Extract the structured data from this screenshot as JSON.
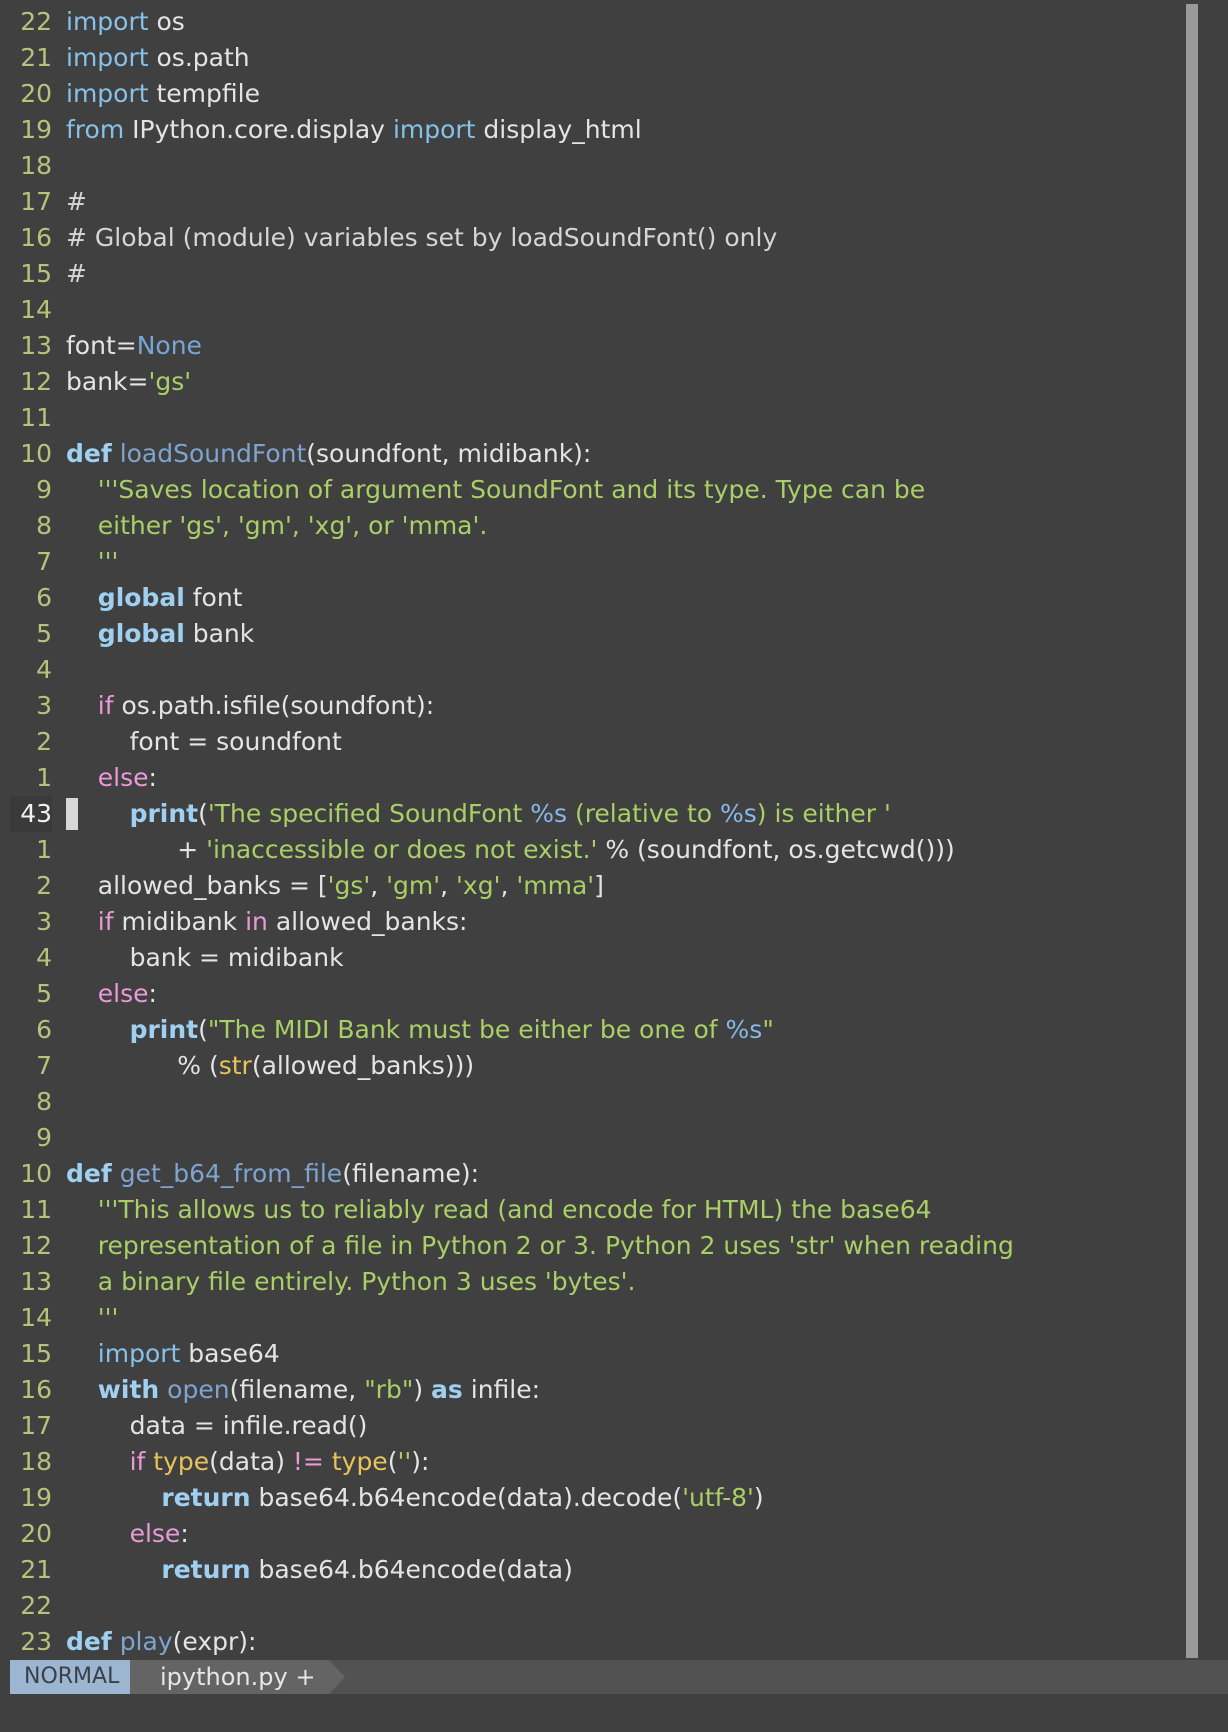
{
  "editor": {
    "lines": [
      {
        "num": "22",
        "segs": [
          [
            "kw",
            "import"
          ],
          [
            "",
            " os"
          ]
        ]
      },
      {
        "num": "21",
        "segs": [
          [
            "kw",
            "import"
          ],
          [
            "",
            " os.path"
          ]
        ]
      },
      {
        "num": "20",
        "segs": [
          [
            "kw",
            "import"
          ],
          [
            "",
            " tempfile"
          ]
        ]
      },
      {
        "num": "19",
        "segs": [
          [
            "kw",
            "from"
          ],
          [
            "",
            " IPython.core.display "
          ],
          [
            "kw",
            "import"
          ],
          [
            "",
            " display_html"
          ]
        ]
      },
      {
        "num": "18",
        "segs": []
      },
      {
        "num": "17",
        "segs": [
          [
            "cmt",
            "#"
          ]
        ]
      },
      {
        "num": "16",
        "segs": [
          [
            "cmt",
            "# Global (module) variables set by loadSoundFont() only"
          ]
        ]
      },
      {
        "num": "15",
        "segs": [
          [
            "cmt",
            "#"
          ]
        ]
      },
      {
        "num": "14",
        "segs": []
      },
      {
        "num": "13",
        "segs": [
          [
            "",
            "font="
          ],
          [
            "none",
            "None"
          ]
        ]
      },
      {
        "num": "12",
        "segs": [
          [
            "",
            "bank="
          ],
          [
            "str",
            "'gs'"
          ]
        ]
      },
      {
        "num": "11",
        "segs": []
      },
      {
        "num": "10",
        "segs": [
          [
            "kwb",
            "def"
          ],
          [
            "",
            " "
          ],
          [
            "fn",
            "loadSoundFont"
          ],
          [
            "",
            "(soundfont, midibank):"
          ]
        ]
      },
      {
        "num": "9",
        "segs": [
          [
            "",
            "    "
          ],
          [
            "str",
            "'''Saves location of argument SoundFont and its type. Type can be"
          ]
        ]
      },
      {
        "num": "8",
        "segs": [
          [
            "",
            "    "
          ],
          [
            "str",
            "either 'gs', 'gm', 'xg', or 'mma'."
          ]
        ]
      },
      {
        "num": "7",
        "segs": [
          [
            "",
            "    "
          ],
          [
            "str",
            "'''"
          ]
        ]
      },
      {
        "num": "6",
        "segs": [
          [
            "",
            "    "
          ],
          [
            "kwb",
            "global"
          ],
          [
            "",
            " font"
          ]
        ]
      },
      {
        "num": "5",
        "segs": [
          [
            "",
            "    "
          ],
          [
            "kwb",
            "global"
          ],
          [
            "",
            " bank"
          ]
        ]
      },
      {
        "num": "4",
        "segs": []
      },
      {
        "num": "3",
        "segs": [
          [
            "",
            "    "
          ],
          [
            "ctl",
            "if"
          ],
          [
            "",
            " os.path.isfile(soundfont):"
          ]
        ]
      },
      {
        "num": "2",
        "segs": [
          [
            "",
            "        font = soundfont"
          ]
        ]
      },
      {
        "num": "1",
        "segs": [
          [
            "",
            "    "
          ],
          [
            "ctl",
            "else"
          ],
          [
            "",
            ":"
          ]
        ]
      },
      {
        "num": "43",
        "current": true,
        "segs": [
          [
            "",
            "        "
          ],
          [
            "kwb",
            "print"
          ],
          [
            "",
            "("
          ],
          [
            "str",
            "'The specified SoundFont "
          ],
          [
            "fmt",
            "%s"
          ],
          [
            "str",
            " (relative to "
          ],
          [
            "fmt",
            "%s"
          ],
          [
            "str",
            ") is either '"
          ]
        ]
      },
      {
        "num": "1",
        "segs": [
          [
            "",
            "              + "
          ],
          [
            "str",
            "'inaccessible or does not exist.'"
          ],
          [
            "",
            " % (soundfont, os.getcwd()))"
          ]
        ]
      },
      {
        "num": "2",
        "segs": [
          [
            "",
            "    allowed_banks = ["
          ],
          [
            "str",
            "'gs'"
          ],
          [
            "",
            ", "
          ],
          [
            "str",
            "'gm'"
          ],
          [
            "",
            ", "
          ],
          [
            "str",
            "'xg'"
          ],
          [
            "",
            ", "
          ],
          [
            "str",
            "'mma'"
          ],
          [
            "",
            "]"
          ]
        ]
      },
      {
        "num": "3",
        "segs": [
          [
            "",
            "    "
          ],
          [
            "ctl",
            "if"
          ],
          [
            "",
            " midibank "
          ],
          [
            "ctl",
            "in"
          ],
          [
            "",
            " allowed_banks:"
          ]
        ]
      },
      {
        "num": "4",
        "segs": [
          [
            "",
            "        bank = midibank"
          ]
        ]
      },
      {
        "num": "5",
        "segs": [
          [
            "",
            "    "
          ],
          [
            "ctl",
            "else"
          ],
          [
            "",
            ":"
          ]
        ]
      },
      {
        "num": "6",
        "segs": [
          [
            "",
            "        "
          ],
          [
            "kwb",
            "print"
          ],
          [
            "",
            "("
          ],
          [
            "str",
            "\"The MIDI Bank must be either be one of "
          ],
          [
            "fmt",
            "%s"
          ],
          [
            "str",
            "\""
          ]
        ]
      },
      {
        "num": "7",
        "segs": [
          [
            "",
            "              % ("
          ],
          [
            "bi",
            "str"
          ],
          [
            "",
            "(allowed_banks)))"
          ]
        ]
      },
      {
        "num": "8",
        "segs": []
      },
      {
        "num": "9",
        "segs": []
      },
      {
        "num": "10",
        "segs": [
          [
            "kwb",
            "def"
          ],
          [
            "",
            " "
          ],
          [
            "fn",
            "get_b64_from_file"
          ],
          [
            "",
            "(filename):"
          ]
        ]
      },
      {
        "num": "11",
        "segs": [
          [
            "",
            "    "
          ],
          [
            "str",
            "'''This allows us to reliably read (and encode for HTML) the base64"
          ]
        ]
      },
      {
        "num": "12",
        "segs": [
          [
            "",
            "    "
          ],
          [
            "str",
            "representation of a file in Python 2 or 3. Python 2 uses 'str' when reading"
          ]
        ]
      },
      {
        "num": "13",
        "segs": [
          [
            "",
            "    "
          ],
          [
            "str",
            "a binary file entirely. Python 3 uses 'bytes'."
          ]
        ]
      },
      {
        "num": "14",
        "segs": [
          [
            "",
            "    "
          ],
          [
            "str",
            "'''"
          ]
        ]
      },
      {
        "num": "15",
        "segs": [
          [
            "",
            "    "
          ],
          [
            "kw",
            "import"
          ],
          [
            "",
            " base64"
          ]
        ]
      },
      {
        "num": "16",
        "segs": [
          [
            "",
            "    "
          ],
          [
            "kwb",
            "with"
          ],
          [
            "",
            " "
          ],
          [
            "fn",
            "open"
          ],
          [
            "",
            "(filename, "
          ],
          [
            "str",
            "\"rb\""
          ],
          [
            "",
            ") "
          ],
          [
            "kwb",
            "as"
          ],
          [
            "",
            " infile:"
          ]
        ]
      },
      {
        "num": "17",
        "segs": [
          [
            "",
            "        data = infile.read()"
          ]
        ]
      },
      {
        "num": "18",
        "segs": [
          [
            "",
            "        "
          ],
          [
            "ctl",
            "if"
          ],
          [
            "",
            " "
          ],
          [
            "bi",
            "type"
          ],
          [
            "",
            "(data) "
          ],
          [
            "ctl",
            "!="
          ],
          [
            "",
            " "
          ],
          [
            "bi",
            "type"
          ],
          [
            "",
            "("
          ],
          [
            "str",
            "''"
          ],
          [
            "",
            "):"
          ]
        ]
      },
      {
        "num": "19",
        "segs": [
          [
            "",
            "            "
          ],
          [
            "kwb",
            "return"
          ],
          [
            "",
            " base64.b64encode(data).decode("
          ],
          [
            "str",
            "'utf-8'"
          ],
          [
            "",
            ")"
          ]
        ]
      },
      {
        "num": "20",
        "segs": [
          [
            "",
            "        "
          ],
          [
            "ctl",
            "else"
          ],
          [
            "",
            ":"
          ]
        ]
      },
      {
        "num": "21",
        "segs": [
          [
            "",
            "            "
          ],
          [
            "kwb",
            "return"
          ],
          [
            "",
            " base64.b64encode(data)"
          ]
        ]
      },
      {
        "num": "22",
        "segs": []
      },
      {
        "num": "23",
        "segs": [
          [
            "kwb",
            "def"
          ],
          [
            "",
            " "
          ],
          [
            "fn",
            "play"
          ],
          [
            "",
            "(expr):"
          ]
        ]
      }
    ]
  },
  "statusbar": {
    "mode": "NORMAL",
    "filename": "ipython.py +"
  },
  "colors": {
    "background": "#404040",
    "line_number": "#b6c47a",
    "string": "#a9cf66",
    "keyword": "#9fd0f2",
    "control": "#e99ad8",
    "function": "#7ea4cf",
    "builtin": "#e7c35a",
    "mode_badge": "#9cb6d2"
  }
}
